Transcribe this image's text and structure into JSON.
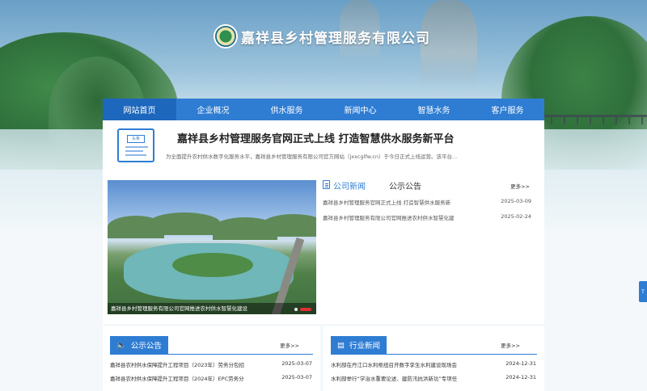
{
  "header": {
    "company_name": "嘉祥县乡村管理服务有限公司"
  },
  "nav": {
    "items": [
      {
        "label": "网站首页"
      },
      {
        "label": "企业概况"
      },
      {
        "label": "供水服务"
      },
      {
        "label": "新闻中心"
      },
      {
        "label": "智慧水务"
      },
      {
        "label": "客户服务"
      }
    ]
  },
  "headline": {
    "icon_label": "头条",
    "title": "嘉祥县乡村管理服务官网正式上线 打造智慧供水服务新平台",
    "description": "为全面提升农村供水数字化服务水平，嘉祥县乡村管理服务有限公司官方网站（jxxcglfw.cn）于今日正式上线运营。该平台..."
  },
  "carousel": {
    "caption": "嘉祥县乡村管理服务有限公司官网推进农村供水智慧化建设"
  },
  "news_panel": {
    "tab_company": "公司新闻",
    "tab_notice": "公示公告",
    "more": "更多>>",
    "items": [
      {
        "title": "嘉祥县乡村管理服务官网正式上线 打造智慧供水服务新",
        "date": "2025-03-09"
      },
      {
        "title": "嘉祥县乡村管理服务有限公司官网推进农村供水智慧化建",
        "date": "2025-02-24"
      }
    ]
  },
  "notices": {
    "title": "公示公告",
    "more": "更多>>",
    "items": [
      {
        "title": "嘉祥县农村供水保障提升工程项目（2023年）劳务分包招",
        "date": "2025-03-07"
      },
      {
        "title": "嘉祥县农村供水保障提升工程项目（2024年）EPC劳务分",
        "date": "2025-03-07"
      }
    ]
  },
  "industry": {
    "title": "行业新闻",
    "more": "更多>>",
    "items": [
      {
        "title": "水利部在丹江口水利枢纽召开数字孪生水利建设现场会",
        "date": "2024-12-31"
      },
      {
        "title": "水利部举行“学治水重要论述、建防汛抗洪新功”专项任",
        "date": "2024-12-31"
      }
    ]
  },
  "side_button": {
    "label": "T"
  }
}
